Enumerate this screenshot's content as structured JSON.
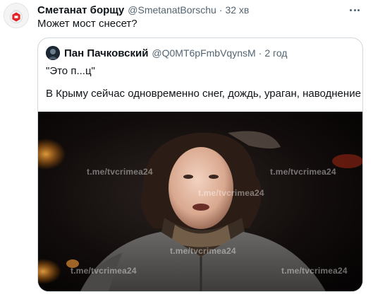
{
  "tweet": {
    "author_name": "Сметанат борщу",
    "author_handle": "@SmetanatBorschu",
    "separator": "·",
    "time": "32 хв",
    "text": "Может мост снесет?",
    "more_icon": "more-horizontal-icon"
  },
  "quote": {
    "author_name": "Пан Пачковский",
    "author_handle": "@Q0MT6pFmbVqynsM",
    "separator": "·",
    "time": "2 год",
    "line1": "\"Это п...ц\"",
    "line2": "В Крыму сейчас одновременно снег, дождь, ураган, наводнение",
    "media": {
      "description_icon": "video-frame",
      "watermarks": [
        "t.me/tvcrimea24",
        "t.me/tvcrimea24",
        "t.me/tvcrimea24",
        "t.me/tvcrimea24",
        "t.me/tvcrimea24",
        "t.me/tvcrimea24"
      ]
    }
  },
  "colors": {
    "text_primary": "#0f1419",
    "text_secondary": "#536471",
    "border": "#cfd9de",
    "avatar_accent": "#e0242a"
  }
}
